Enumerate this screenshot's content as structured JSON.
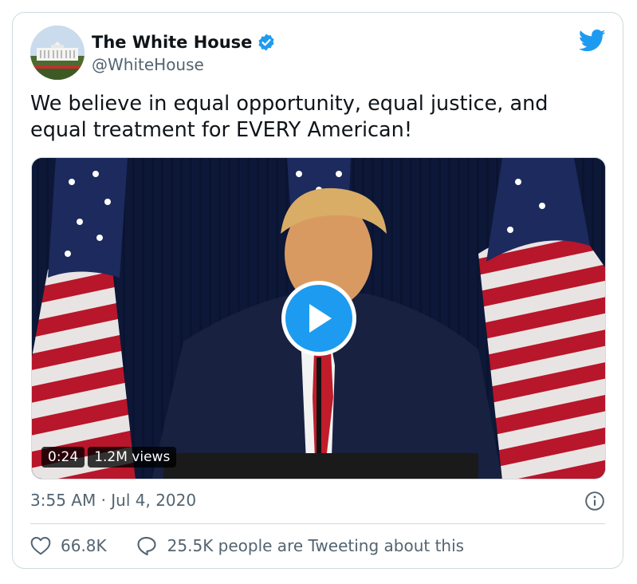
{
  "account": {
    "name": "The White House",
    "handle": "@WhiteHouse"
  },
  "tweet": {
    "text_line1": "We believe in equal opportunity, equal justice, and",
    "text_line2": "equal treatment for EVERY American!"
  },
  "video": {
    "duration": "0:24",
    "views": "1.2M views"
  },
  "timestamp": "3:55 AM · Jul 4, 2020",
  "actions": {
    "likes": "66.8K",
    "conversation": "25.5K people are Tweeting about this"
  },
  "colors": {
    "accent": "#1d9bf0",
    "text": "#0f1419",
    "secondary": "#536471",
    "border": "#cfd9de"
  },
  "icons": [
    "verified-badge-icon",
    "twitter-bird-icon",
    "play-icon",
    "info-icon",
    "heart-icon",
    "comment-icon"
  ]
}
